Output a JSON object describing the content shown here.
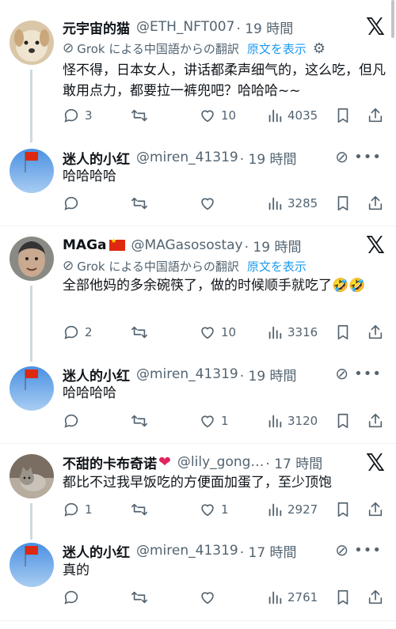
{
  "icons": {
    "reply": "reply-icon",
    "repost": "repost-icon",
    "like": "heart-icon",
    "views": "views-icon",
    "bookmark": "bookmark-icon",
    "share": "share-icon"
  },
  "colors": {
    "accent": "#1d9bf0",
    "muted": "#536471",
    "text": "#0f1419",
    "line": "#cfd9de"
  },
  "posts": [
    {
      "name": "元宇宙的猫",
      "handle": "@ETH_NFT007",
      "time": "· 19 時間",
      "translate_label": "Grok による中国語からの翻訳",
      "show_original": "原文を表示",
      "text": "怪不得，日本女人，讲话都柔声细气的，这么吃，但凡敢用点力，都要拉一裤兜吧？哈哈哈~~",
      "replies": "3",
      "reposts": "",
      "likes": "10",
      "views": "4035"
    },
    {
      "name": "迷人的小红",
      "handle": "@miren_41319",
      "time": "· 19 時間",
      "text": "哈哈哈哈",
      "replies": "",
      "reposts": "",
      "likes": "",
      "views": "3285"
    },
    {
      "name": "MAGa",
      "handle": "@MAGasosostay",
      "time": "· 19 時間",
      "translate_label": "Grok による中国語からの翻訳",
      "show_original": "原文を表示",
      "text": "全部他妈的多余碗筷了，做的时候顺手就吃了🤣🤣",
      "replies": "2",
      "reposts": "",
      "likes": "10",
      "views": "3316"
    },
    {
      "name": "迷人的小红",
      "handle": "@miren_41319",
      "time": "· 19 時間",
      "text": "哈哈哈哈",
      "replies": "",
      "reposts": "",
      "likes": "1",
      "views": "3120"
    },
    {
      "name": "不甜的卡布奇诺",
      "handle": "@lily_gong…",
      "time": "· 17 時間",
      "text": "都比不过我早饭吃的方便面加蛋了，至少顶饱",
      "replies": "1",
      "reposts": "",
      "likes": "1",
      "views": "2927"
    },
    {
      "name": "迷人的小红",
      "handle": "@miren_41319",
      "time": "· 17 時間",
      "text": "真的",
      "replies": "",
      "reposts": "",
      "likes": "",
      "views": "2761"
    }
  ]
}
